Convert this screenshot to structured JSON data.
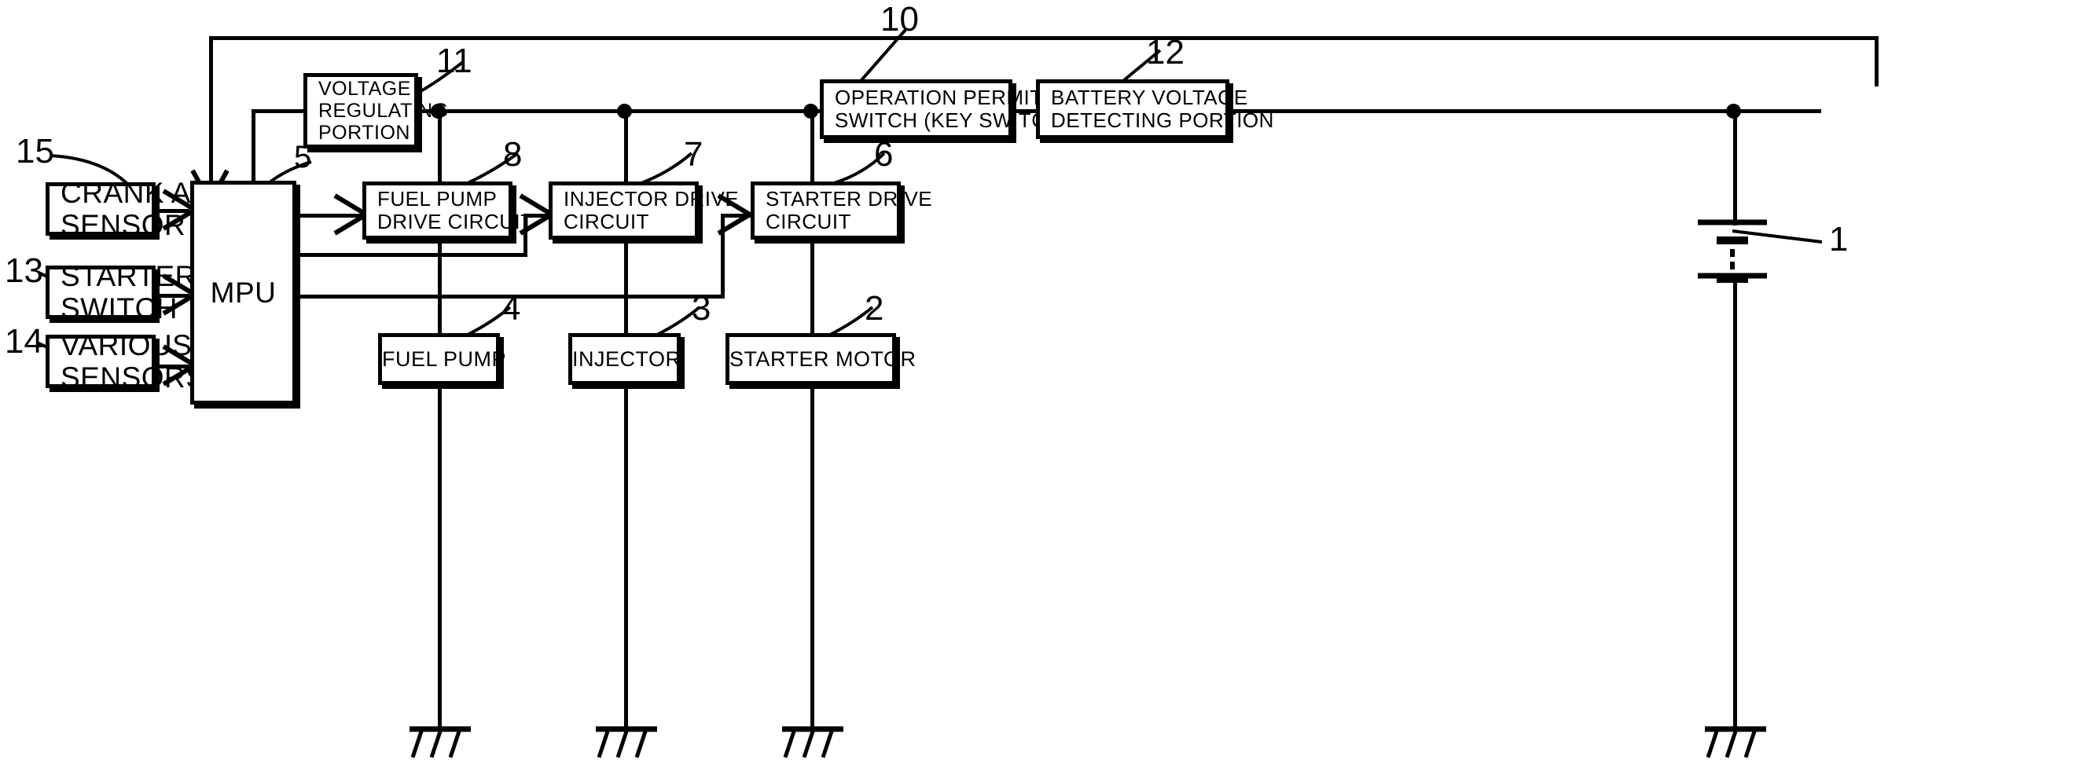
{
  "figure": {
    "kind": "patent-block-diagram",
    "title": "",
    "ink_color": "#000000",
    "background_color": "#ffffff"
  },
  "blocks": {
    "crank_angle_sensor": {
      "lines": [
        "CRANK ANGLE",
        "SENSOR"
      ],
      "ref": "15"
    },
    "starter_switch": {
      "lines": [
        "STARTER",
        "SWITCH"
      ],
      "ref": "13"
    },
    "various_sensors": {
      "lines": [
        "VARIOUS",
        "SENSORS"
      ],
      "ref": "14"
    },
    "mpu": {
      "lines": [
        "MPU"
      ],
      "ref": "5"
    },
    "voltage_regulating_portion": {
      "lines": [
        "VOLTAGE",
        "REGULATING",
        "PORTION"
      ],
      "ref": "11"
    },
    "fuel_pump_drive_circuit": {
      "lines": [
        "FUEL PUMP",
        "DRIVE CIRCUIT"
      ],
      "ref": "8"
    },
    "injector_drive_circuit": {
      "lines": [
        "INJECTOR DRIVE",
        "CIRCUIT"
      ],
      "ref": "7"
    },
    "starter_drive_circuit": {
      "lines": [
        "STARTER DRIVE",
        "CIRCUIT"
      ],
      "ref": "6"
    },
    "operation_permit_switch": {
      "lines": [
        "OPERATION PERMIT",
        "SWITCH (KEY SWITCH)"
      ],
      "ref": "10"
    },
    "battery_voltage_detecting_portion": {
      "lines": [
        "BATTERY VOLTAGE",
        "DETECTING PORTION"
      ],
      "ref": "12"
    },
    "fuel_pump": {
      "lines": [
        "FUEL PUMP"
      ],
      "ref": "4"
    },
    "injector": {
      "lines": [
        "INJECTOR"
      ],
      "ref": "3"
    },
    "starter_motor": {
      "lines": [
        "STARTER MOTOR"
      ],
      "ref": "2"
    },
    "battery": {
      "lines": [],
      "ref": "1"
    }
  },
  "reference_numerals": {
    "n1": "1",
    "n2": "2",
    "n3": "3",
    "n4": "4",
    "n5": "5",
    "n6": "6",
    "n7": "7",
    "n8": "8",
    "n10": "10",
    "n11": "11",
    "n12": "12",
    "n13": "13",
    "n14": "14",
    "n15": "15"
  },
  "symbols": {
    "ground": "ground-symbol",
    "battery": "battery-cell-symbol",
    "junction": "junction-dot"
  }
}
